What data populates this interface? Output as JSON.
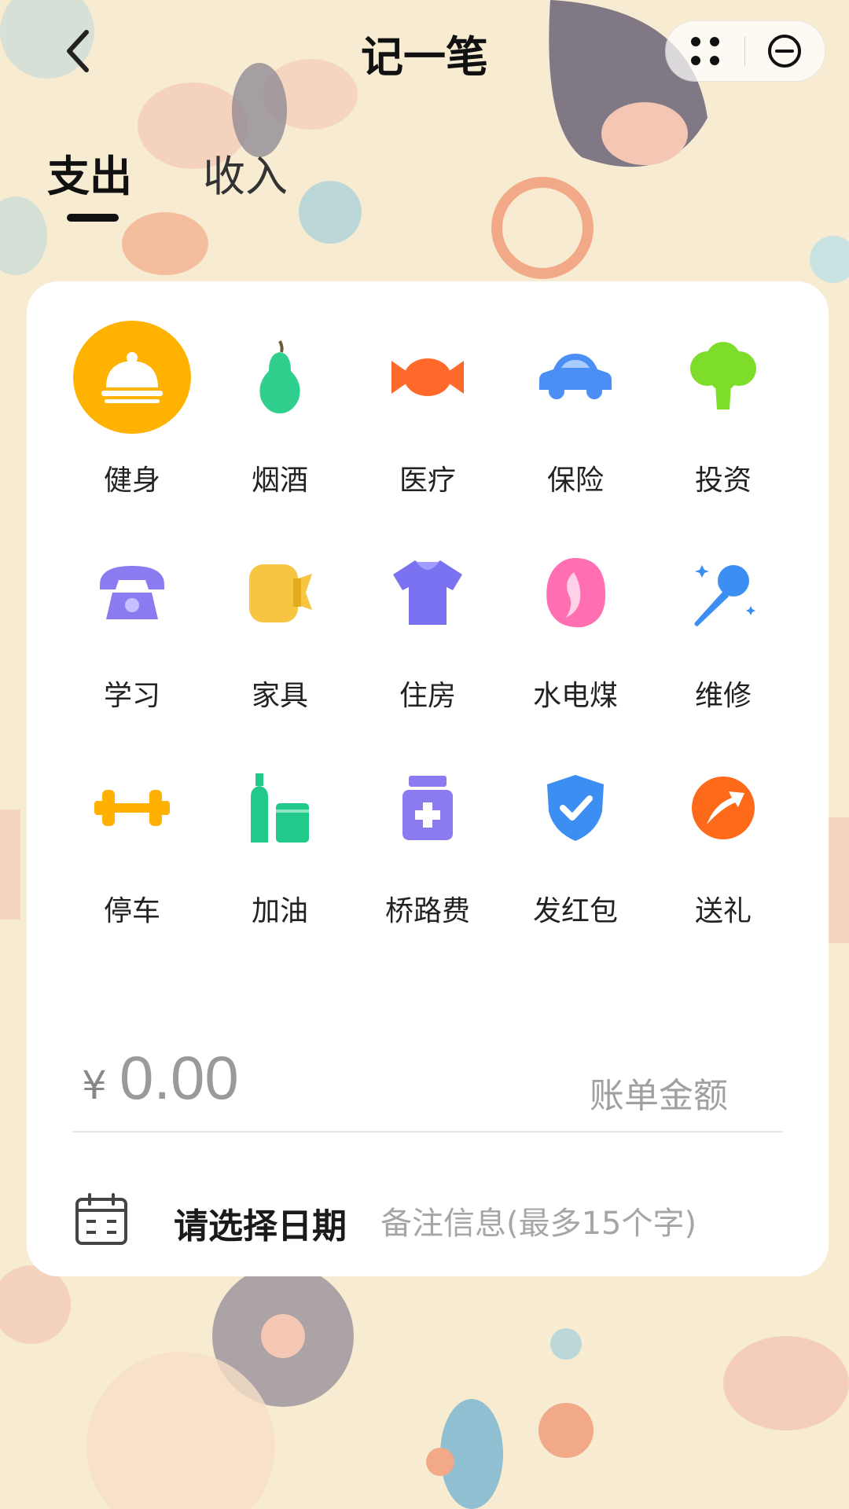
{
  "header": {
    "title": "记一笔"
  },
  "tabs": [
    {
      "label": "支出",
      "active": true
    },
    {
      "label": "收入",
      "active": false
    }
  ],
  "categories": [
    {
      "label": "健身",
      "icon": "dish-cover-icon",
      "color": "#ffffff",
      "selected": true
    },
    {
      "label": "烟酒",
      "icon": "pear-icon",
      "color": "#2fd08d"
    },
    {
      "label": "医疗",
      "icon": "candy-icon",
      "color": "#ff6a2b"
    },
    {
      "label": "保险",
      "icon": "car-icon",
      "color": "#4b8ef5"
    },
    {
      "label": "投资",
      "icon": "broccoli-icon",
      "color": "#7ddd2a"
    },
    {
      "label": "学习",
      "icon": "telephone-icon",
      "color": "#8a7cf0"
    },
    {
      "label": "家具",
      "icon": "tape-icon",
      "color": "#f7c542"
    },
    {
      "label": "住房",
      "icon": "tshirt-icon",
      "color": "#7b72f1"
    },
    {
      "label": "水电煤",
      "icon": "hair-icon",
      "color": "#ff6fb2"
    },
    {
      "label": "维修",
      "icon": "microphone-icon",
      "color": "#3c8ef3"
    },
    {
      "label": "停车",
      "icon": "dumbbell-icon",
      "color": "#ffb000"
    },
    {
      "label": "加油",
      "icon": "bottles-icon",
      "color": "#21c98a"
    },
    {
      "label": "桥路费",
      "icon": "medicine-bottle-icon",
      "color": "#8a7cf0"
    },
    {
      "label": "发红包",
      "icon": "shield-check-icon",
      "color": "#3c8ef3"
    },
    {
      "label": "送礼",
      "icon": "arrow-circle-icon",
      "color": "#ff6a1a"
    }
  ],
  "amount": {
    "currency": "¥",
    "value": "0.00",
    "hint": "账单金额"
  },
  "date": {
    "label": "请选择日期"
  },
  "remark": {
    "placeholder": "备注信息(最多15个字)"
  },
  "colors": {
    "selected_bg": "#ffb300",
    "card_bg": "#ffffff"
  }
}
